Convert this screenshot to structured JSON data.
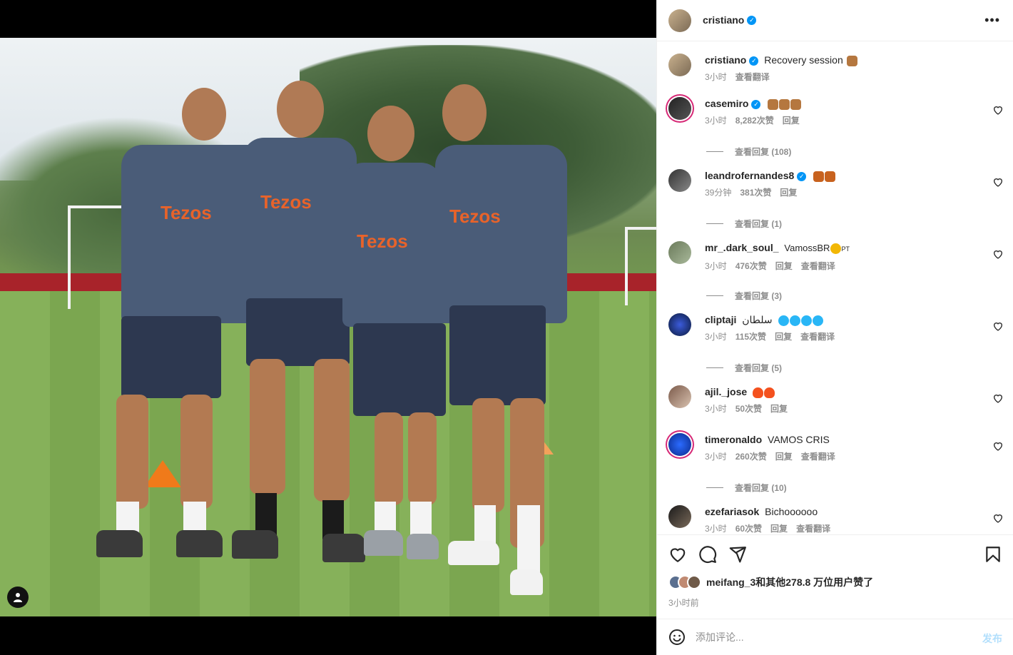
{
  "post": {
    "username": "cristiano",
    "caption": "Recovery session",
    "caption_time": "3小时",
    "caption_translate": "查看翻译"
  },
  "photo": {
    "sponsor_text": "Tezos"
  },
  "comments": [
    {
      "user": "casemiro",
      "verified": true,
      "text": "",
      "emoji_count": 3,
      "emoji_color": "#b5773f",
      "time": "3小时",
      "likes": "8,282次赞",
      "reply": "回复",
      "translate": "",
      "replies": "查看回复 (108)"
    },
    {
      "user": "leandrofernandes8",
      "verified": true,
      "text": "",
      "emoji_count": 2,
      "emoji_color": "#c8621e",
      "time": "39分钟",
      "likes": "381次赞",
      "reply": "回复",
      "translate": "",
      "replies": "查看回复 (1)"
    },
    {
      "user": "mr_.dark_soul_",
      "verified": false,
      "text": "VamossBR",
      "text_suffix": "PT",
      "emoji_count": 1,
      "emoji_color": "#f2b705",
      "time": "3小时",
      "likes": "476次赞",
      "reply": "回复",
      "translate": "查看翻译",
      "replies": "查看回复 (3)"
    },
    {
      "user": "cliptaji",
      "verified": false,
      "text": "سلطان",
      "emoji_count": 4,
      "emoji_color": "#29b6f6",
      "time": "3小时",
      "likes": "115次赞",
      "reply": "回复",
      "translate": "查看翻译",
      "replies": "查看回复 (5)"
    },
    {
      "user": "ajil._jose",
      "verified": false,
      "text": "",
      "emoji_count": 2,
      "emoji_color": "#f4511e",
      "time": "3小时",
      "likes": "50次赞",
      "reply": "回复",
      "translate": "",
      "replies": ""
    },
    {
      "user": "timeronaldo",
      "verified": false,
      "text": "VAMOS CRIS",
      "emoji_count": 0,
      "emoji_color": "",
      "time": "3小时",
      "likes": "260次赞",
      "reply": "回复",
      "translate": "查看翻译",
      "replies": "查看回复 (10)"
    },
    {
      "user": "ezefariasok",
      "verified": false,
      "text": "Bichoooooo",
      "emoji_count": 0,
      "emoji_color": "",
      "time": "3小时",
      "likes": "60次赞",
      "reply": "回复",
      "translate": "查看翻译",
      "replies": ""
    }
  ],
  "likes_summary": {
    "text": "meifang_3和其他278.8 万位用户赞了"
  },
  "time_ago": "3小时前",
  "add_comment": {
    "placeholder": "添加评论...",
    "post_label": "发布"
  },
  "colors": {
    "accent": "#0095f6",
    "muted": "#8e8e8e",
    "post_disabled": "#b2dffc"
  }
}
